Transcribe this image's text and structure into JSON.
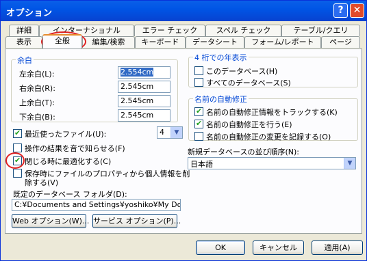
{
  "window": {
    "title": "オプション"
  },
  "tabs": {
    "row1": [
      "詳細",
      "インターナショナル",
      "エラー チェック",
      "スペル チェック",
      "テーブル/クエリ"
    ],
    "row2": [
      "表示",
      "全般",
      "編集/検索",
      "キーボード",
      "データシート",
      "フォーム/レポート",
      "ページ"
    ]
  },
  "margins": {
    "title": "余白",
    "left_label": "左余白(L):",
    "left_value": "2.554cm",
    "right_label": "右余白(R):",
    "right_value": "2.545cm",
    "top_label": "上余白(T):",
    "top_value": "2.545cm",
    "bottom_label": "下余白(B):",
    "bottom_value": "2.545cm"
  },
  "general": {
    "recent_files_label": "最近使ったファイル(U):",
    "recent_files_value": "4",
    "sound_label": "操作の結果を音で知らせる(F)",
    "compact_label": "閉じる時に最適化する(C)",
    "remove_info_label_1": "保存時にファイルのプロパティから個人情報を削",
    "remove_info_label_2": "除する(V)",
    "default_folder_label": "既定のデータベース フォルダ(D):",
    "default_folder_value": "C:¥Documents and Settings¥yoshiko¥My Documents",
    "web_options": "Web オプション(W)...",
    "service_options": "サービス オプション(P)..."
  },
  "year4": {
    "title": "4 桁での年表示",
    "this_db": "このデータベース(H)",
    "all_db": "すべてのデータベース(S)"
  },
  "autocorrect": {
    "title": "名前の自動修正",
    "track": "名前の自動修正情報をトラックする(K)",
    "perform": "名前の自動修正を行う(E)",
    "log": "名前の自動修正の変更を記録する(O)"
  },
  "sort": {
    "label": "新規データベースの並び順序(N):",
    "value": "日本語"
  },
  "footer": {
    "ok": "OK",
    "cancel": "キャンセル",
    "apply": "適用(A)"
  },
  "colors": {
    "accent": "#0046d5",
    "annotation": "#e02020"
  }
}
